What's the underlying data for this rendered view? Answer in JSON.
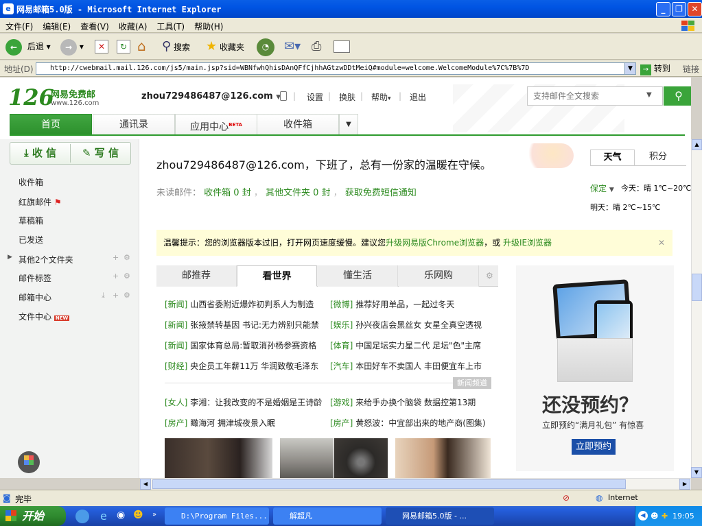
{
  "window": {
    "title": "网易邮箱5.0版 - Microsoft Internet Explorer",
    "menu": [
      "文件(F)",
      "编辑(E)",
      "查看(V)",
      "收藏(A)",
      "工具(T)",
      "帮助(H)"
    ],
    "toolbar": {
      "back": "后退",
      "search": "搜索",
      "favorites": "收藏夹"
    },
    "address_label": "地址(D)",
    "address_url": "http://cwebmail.mail.126.com/js5/main.jsp?sid=WBNfwhQhisDAnQFfCjhhAGtzwDDtMeiQ#module=welcome.WelcomeModule%7C%7B%7D",
    "go_label": "转到",
    "links_label": "链接",
    "status_text": "完毕",
    "zone_text": "Internet"
  },
  "taskbar": {
    "start_label": "开始",
    "tasks": [
      "D:\\Program Files...",
      "解超凡",
      "网易邮箱5.0版 - ..."
    ],
    "clock": "19:05"
  },
  "mail": {
    "logo_number": "126",
    "logo_name": "网易免费邮",
    "logo_domain": "www.126.com",
    "user": "zhou729486487@126.com",
    "header_links": [
      "设置",
      "换肤",
      "帮助",
      "退出"
    ],
    "search_placeholder": "支持邮件全文搜索",
    "nav_tabs": [
      "首页",
      "通讯录",
      "应用中心",
      "收件箱"
    ],
    "beta_label": "BETA",
    "receive_btn": "收 信",
    "write_btn": "写 信",
    "folders": [
      "收件箱",
      "红旗邮件",
      "草稿箱",
      "已发送",
      "其他2个文件夹",
      "邮件标签",
      "邮箱中心",
      "文件中心"
    ],
    "new_badge": "NEW",
    "greeting": "zhou729486487@126.com，下班了，总有一份家的温暖在守候。",
    "unread_label": "未读邮件：",
    "unread_inbox": "收件箱 0 封",
    "unread_other": "其他文件夹 0 封",
    "sms_link": "获取免费短信通知",
    "weather_tabs": [
      "天气",
      "积分"
    ],
    "city": "保定",
    "today": "今天：晴 1℃~20℃",
    "tomorrow": "明天：晴 2℃~15℃",
    "tip_text": "温馨提示：您的浏览器版本过旧，打开网页速度缓慢。建议您",
    "tip_link1": "升级网易版Chrome浏览器",
    "tip_or": "，或",
    "tip_link2": "升级IE浏览器",
    "content_tabs": [
      "邮推荐",
      "看世界",
      "懂生活",
      "乐网购"
    ],
    "news_left": [
      {
        "tag": "[新闻]",
        "text": "山西省委附近爆炸初判系人为制造"
      },
      {
        "tag": "[新闻]",
        "text": "张掖禁转基因 书记:无力辨别只能禁"
      },
      {
        "tag": "[新闻]",
        "text": "国家体育总局:暂取消孙杨参赛资格"
      },
      {
        "tag": "[财经]",
        "text": "央企员工年薪11万 华润致敬毛泽东"
      }
    ],
    "news_right": [
      {
        "tag": "[微博]",
        "text": "推荐好用单品，一起过冬天"
      },
      {
        "tag": "[娱乐]",
        "text": "孙兴夜店会黑丝女 女星全真空透视"
      },
      {
        "tag": "[体育]",
        "text": "中国足坛实力星二代 足坛\"色\"主席"
      },
      {
        "tag": "[汽车]",
        "text": "本田好车不卖国人 丰田便宜车上市"
      }
    ],
    "news_channel": "新闻频道",
    "news_left2": [
      {
        "tag": "[女人]",
        "text": "李湘：让我改变的不是婚姻是王诗龄"
      },
      {
        "tag": "[房产]",
        "text": "瞰海河 拥津城夜景入眠"
      }
    ],
    "news_right2": [
      {
        "tag": "[游戏]",
        "text": "来给手办换个脑袋 数据控第13期"
      },
      {
        "tag": "[房产]",
        "text": "黄怒波：中宜部出来的地产商(图集)"
      }
    ],
    "ad_title": "还没预约？",
    "ad_sub1": "立即预约“满月礼包”",
    "ad_sub2": "有惊喜",
    "ad_btn": "立即预约"
  },
  "colors": {
    "brand_green": "#2c8a1f",
    "xp_blue": "#0054e3",
    "accent_ad": "#1b4fa8"
  }
}
